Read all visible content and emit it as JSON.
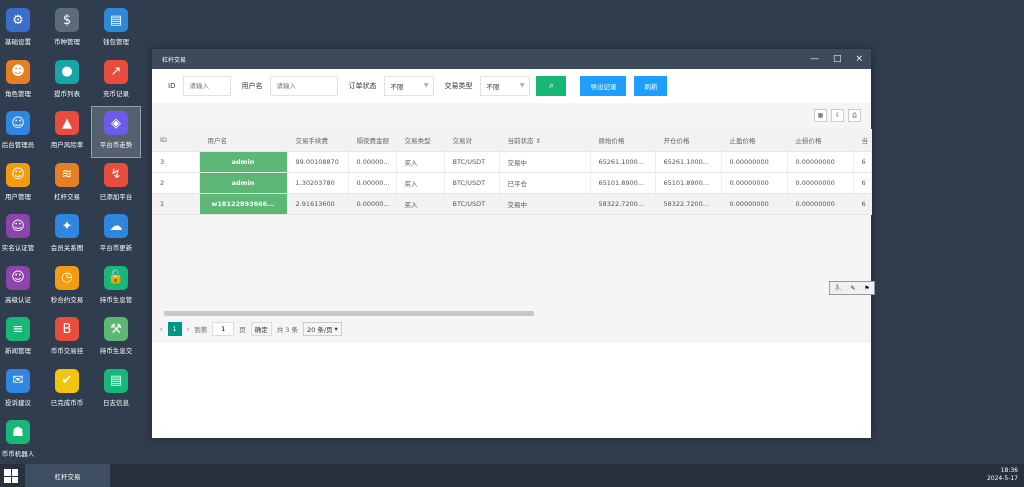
{
  "desktop": {
    "icons": [
      {
        "label": "基础设置",
        "icon": "gear-icon",
        "color": "#3a6fc9",
        "glyph": "⚙"
      },
      {
        "label": "币种管理",
        "icon": "dollar-icon",
        "color": "#5a6b7c",
        "glyph": "$"
      },
      {
        "label": "钱包管理",
        "icon": "wallet-icon",
        "color": "#2e88d8",
        "glyph": "▤"
      },
      {
        "label": "角色管理",
        "icon": "role-icon",
        "color": "#e67e22",
        "glyph": "☻"
      },
      {
        "label": "提币列表",
        "icon": "withdraw-icon",
        "color": "#16a6a6",
        "glyph": "●"
      },
      {
        "label": "充币记录",
        "icon": "deposit-icon",
        "color": "#e74c3c",
        "glyph": "↗"
      },
      {
        "label": "后台管理员",
        "icon": "admin-icon",
        "color": "#2e86de",
        "glyph": "☺"
      },
      {
        "label": "用户风险率",
        "icon": "alarm-icon",
        "color": "#e74c3c",
        "glyph": "▲"
      },
      {
        "label": "平台币走势",
        "icon": "layers-icon",
        "color": "#6c5ce7",
        "glyph": "◈"
      },
      {
        "label": "用户管理",
        "icon": "user-icon",
        "color": "#f39c12",
        "glyph": "☺"
      },
      {
        "label": "杠杆交易",
        "icon": "stack-icon",
        "color": "#e67e22",
        "glyph": "≋"
      },
      {
        "label": "已添加平台",
        "icon": "chart-icon",
        "color": "#e74c3c",
        "glyph": "↯"
      },
      {
        "label": "实名认证管",
        "icon": "verify-icon",
        "color": "#8e44ad",
        "glyph": "☺"
      },
      {
        "label": "会员关系图",
        "icon": "network-icon",
        "color": "#2e86de",
        "glyph": "✦"
      },
      {
        "label": "平台币更新",
        "icon": "cloud-icon",
        "color": "#2e86de",
        "glyph": "☁"
      },
      {
        "label": "高级认证",
        "icon": "advanced-verify-icon",
        "color": "#8e44ad",
        "glyph": "☺"
      },
      {
        "label": "秒合约交易",
        "icon": "timer-icon",
        "color": "#f39c12",
        "glyph": "◷"
      },
      {
        "label": "持币生息管",
        "icon": "lock-icon",
        "color": "#16b777",
        "glyph": "🔓"
      },
      {
        "label": "新闻管理",
        "icon": "news-icon",
        "color": "#16b777",
        "glyph": "≡"
      },
      {
        "label": "币币交易挂",
        "icon": "bitcoin-icon",
        "color": "#e74c3c",
        "glyph": "B"
      },
      {
        "label": "持币生息交",
        "icon": "hammer-icon",
        "color": "#5cb874",
        "glyph": "⚒"
      },
      {
        "label": "投诉建议",
        "icon": "feedback-icon",
        "color": "#2e86de",
        "glyph": "✉"
      },
      {
        "label": "已完成币币",
        "icon": "done-icon",
        "color": "#f1c40f",
        "glyph": "✔"
      },
      {
        "label": "日志信息",
        "icon": "log-icon",
        "color": "#16b777",
        "glyph": "▤"
      },
      {
        "label": "币币机器人",
        "icon": "robot-icon",
        "color": "#16b777",
        "glyph": "☗"
      }
    ]
  },
  "window": {
    "title": "杠杆交易",
    "controls": {
      "minimize": "—",
      "maximize": "□",
      "close": "×"
    }
  },
  "toolbar": {
    "id_label": "ID",
    "id_placeholder": "请输入",
    "username_label": "用户名",
    "username_placeholder": "请输入",
    "order_status_label": "订单状态",
    "order_status_value": "不限",
    "trade_type_label": "交易类型",
    "trade_type_value": "不限",
    "export_label": "导出记录",
    "refresh_label": "刷新"
  },
  "table": {
    "headers": [
      "ID",
      "用户名",
      "交易手续费",
      "隔夜费金额",
      "交易类型",
      "交易对",
      "当前状态 ⇕",
      "原始价格",
      "开仓价格",
      "止盈价格",
      "止损价格",
      "当"
    ],
    "rows": [
      [
        "3",
        "admin",
        "99.00108870",
        "0.00000...",
        "买入",
        "BTC/USDT",
        "交易中",
        "65261.1000...",
        "65261.1000...",
        "0.00000000",
        "0.00000000",
        "6"
      ],
      [
        "2",
        "admin",
        "1.30203780",
        "0.00000...",
        "买入",
        "BTC/USDT",
        "已平仓",
        "65101.8900...",
        "65101.8900...",
        "0.00000000",
        "0.00000000",
        "6"
      ],
      [
        "1",
        "w18122893666...",
        "2.91613600",
        "0.00000...",
        "买入",
        "BTC/USDT",
        "交易中",
        "58322.7200...",
        "58322.7200...",
        "0.00000000",
        "0.00000000",
        "6"
      ]
    ]
  },
  "pager": {
    "prev": "‹",
    "current_page": "1",
    "next": "›",
    "goto_label": "到第",
    "goto_value": "1",
    "page_unit": "页",
    "confirm_label": "确定",
    "total_label": "共 3 条",
    "per_page_label": "20 条/页"
  },
  "taskbar": {
    "active_task": "杠杆交易",
    "time": "18:36",
    "date": "2024-5-17"
  }
}
